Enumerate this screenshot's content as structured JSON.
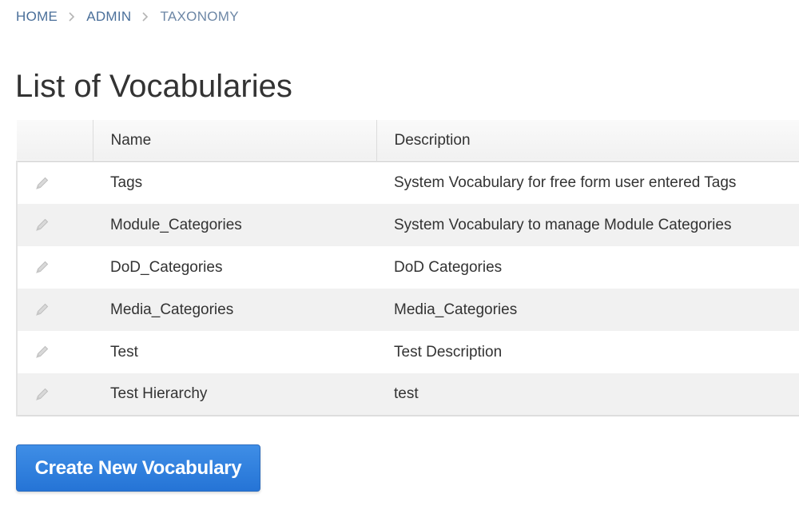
{
  "breadcrumb": {
    "items": [
      {
        "label": "HOME"
      },
      {
        "label": "ADMIN"
      }
    ],
    "current": "TAXONOMY"
  },
  "page_title": "List of Vocabularies",
  "table": {
    "columns": [
      "",
      "Name",
      "Description"
    ],
    "rows": [
      {
        "name": "Tags",
        "description": "System Vocabulary for free form user entered Tags"
      },
      {
        "name": "Module_Categories",
        "description": "System Vocabulary to manage Module Categories"
      },
      {
        "name": "DoD_Categories",
        "description": "DoD Categories"
      },
      {
        "name": "Media_Categories",
        "description": "Media_Categories"
      },
      {
        "name": "Test",
        "description": "Test Description"
      },
      {
        "name": "Test Hierarchy",
        "description": "test"
      }
    ],
    "row_icon": "pencil-icon"
  },
  "actions": {
    "create_label": "Create New Vocabulary"
  },
  "colors": {
    "link": "#4a6f9a",
    "button": "#2a7ad8",
    "row_alt": "#f1f1f1"
  }
}
